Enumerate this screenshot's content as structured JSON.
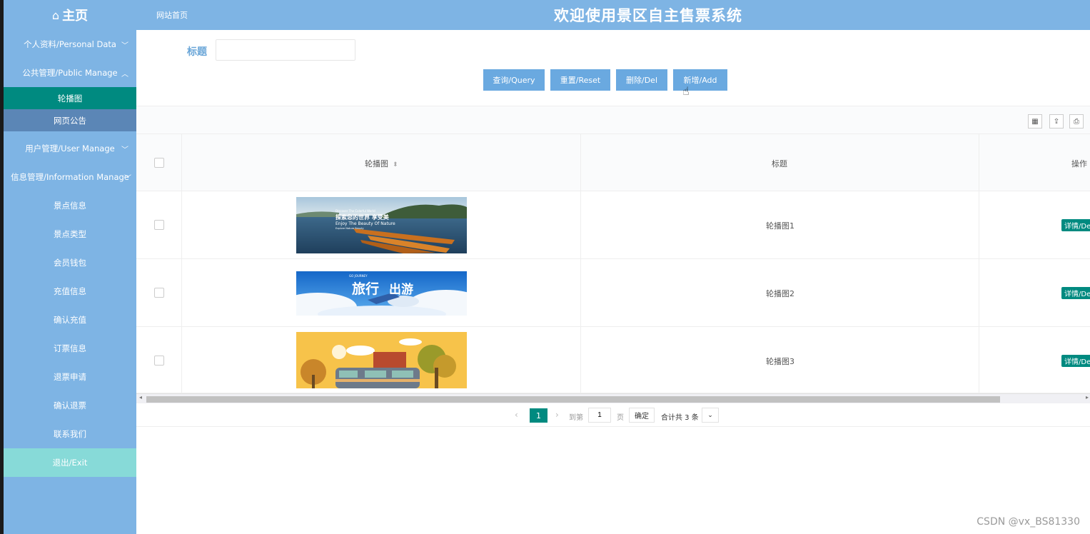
{
  "brand": {
    "title": "主页"
  },
  "header": {
    "home_link": "网站首页",
    "system_title": "欢迎使用景区自主售票系统"
  },
  "sidebar": {
    "personal": "个人资料/Personal Data",
    "public": "公共管理/Public Manage",
    "public_items": [
      "轮播图",
      "网页公告"
    ],
    "user": "用户管理/User Manage",
    "info": "信息管理/Information Manage",
    "info_items": [
      "景点信息",
      "景点类型",
      "会员钱包",
      "充值信息",
      "确认充值",
      "订票信息",
      "退票申请",
      "确认退票",
      "联系我们"
    ],
    "exit": "退出/Exit"
  },
  "search": {
    "label": "标题",
    "value": ""
  },
  "buttons": {
    "query": "查询/Query",
    "reset": "重置/Reset",
    "delete": "删除/Del",
    "add": "新增/Add"
  },
  "table": {
    "headers": {
      "carousel": "轮播图",
      "title": "标题",
      "action": "操作"
    },
    "rows": [
      {
        "title": "轮播图1",
        "action": "详情/De",
        "banner_lines": [
          "Discover The Colorful World",
          "探索您的世界 享受美",
          "Enjoy The Beauty Of Nature",
          "Explore Nature Beauty"
        ]
      },
      {
        "title": "轮播图2",
        "action": "详情/De",
        "banner_lines": [
          "GO JOURNEY",
          "旅行",
          "出游"
        ]
      },
      {
        "title": "轮播图3",
        "action": "详情/De",
        "banner_lines": []
      }
    ]
  },
  "pager": {
    "current": "1",
    "goto_label": "到第",
    "goto_value": "1",
    "page_label": "页",
    "ok": "确定",
    "total": "合计共 3 条"
  },
  "watermark": "CSDN @vx_BS81330",
  "colors": {
    "sidebar": "#7eb4e4",
    "accent": "#008a80",
    "button": "#6aa9e0",
    "exit": "#87dad8"
  }
}
